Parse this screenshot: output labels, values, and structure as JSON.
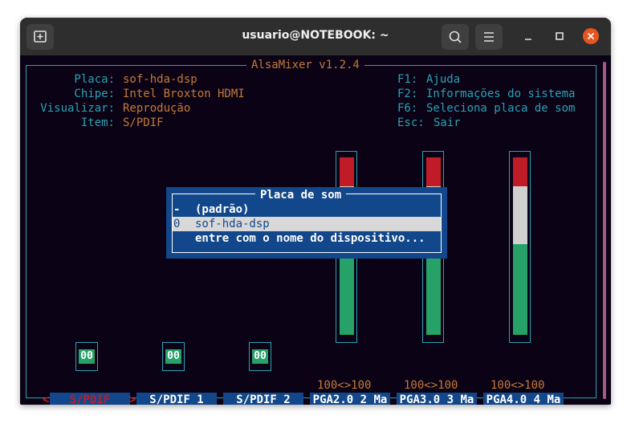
{
  "window": {
    "title": "usuario@NOTEBOOK: ~"
  },
  "mixer": {
    "title": "AlsaMixer v1.2.4",
    "info": [
      {
        "label": "Placa:",
        "value": "sof-hda-dsp"
      },
      {
        "label": "Chipe:",
        "value": "Intel Broxton HDMI"
      },
      {
        "label": "Visualizar:",
        "value": "Reprodução"
      },
      {
        "label": "Item:",
        "value": "S/PDIF"
      }
    ],
    "help": [
      {
        "key": "F1:",
        "desc": "Ajuda"
      },
      {
        "key": "F2:",
        "desc": "Informações do sistema"
      },
      {
        "key": "F6:",
        "desc": "Seleciona placa de som"
      },
      {
        "key": "Esc:",
        "desc": "Sair"
      }
    ],
    "controls": [
      {
        "name": "S/PDIF",
        "type": "switch",
        "value": "00",
        "selected": true
      },
      {
        "name": "S/PDIF 1",
        "type": "switch",
        "value": "00"
      },
      {
        "name": "S/PDIF 2",
        "type": "switch",
        "value": "00"
      },
      {
        "name": "PGA2.0 2 Ma",
        "type": "volume",
        "level_text": "100<>100",
        "level": 1.0
      },
      {
        "name": "PGA3.0 3 Ma",
        "type": "volume",
        "level_text": "100<>100",
        "level": 1.0
      },
      {
        "name": "PGA4.0 4 Ma",
        "type": "volume",
        "level_text": "100<>100",
        "level": 1.0
      }
    ],
    "nav": {
      "left": "<",
      "right": ">"
    }
  },
  "dialog": {
    "title": "Placa de som",
    "items": [
      {
        "key": "-",
        "label": "(padrão)"
      },
      {
        "key": "0",
        "label": "sof-hda-dsp",
        "selected": true
      },
      {
        "key": "",
        "label": "entre com o nome do dispositivo..."
      }
    ]
  },
  "colors": {
    "terminal_bg": "#0b0315",
    "cyan": "#2aa1b3",
    "orange": "#c4793a",
    "dialog_bg": "#12488b",
    "meter_red": "#c01c28",
    "meter_white": "#d0d0d0",
    "meter_green": "#26a269"
  }
}
